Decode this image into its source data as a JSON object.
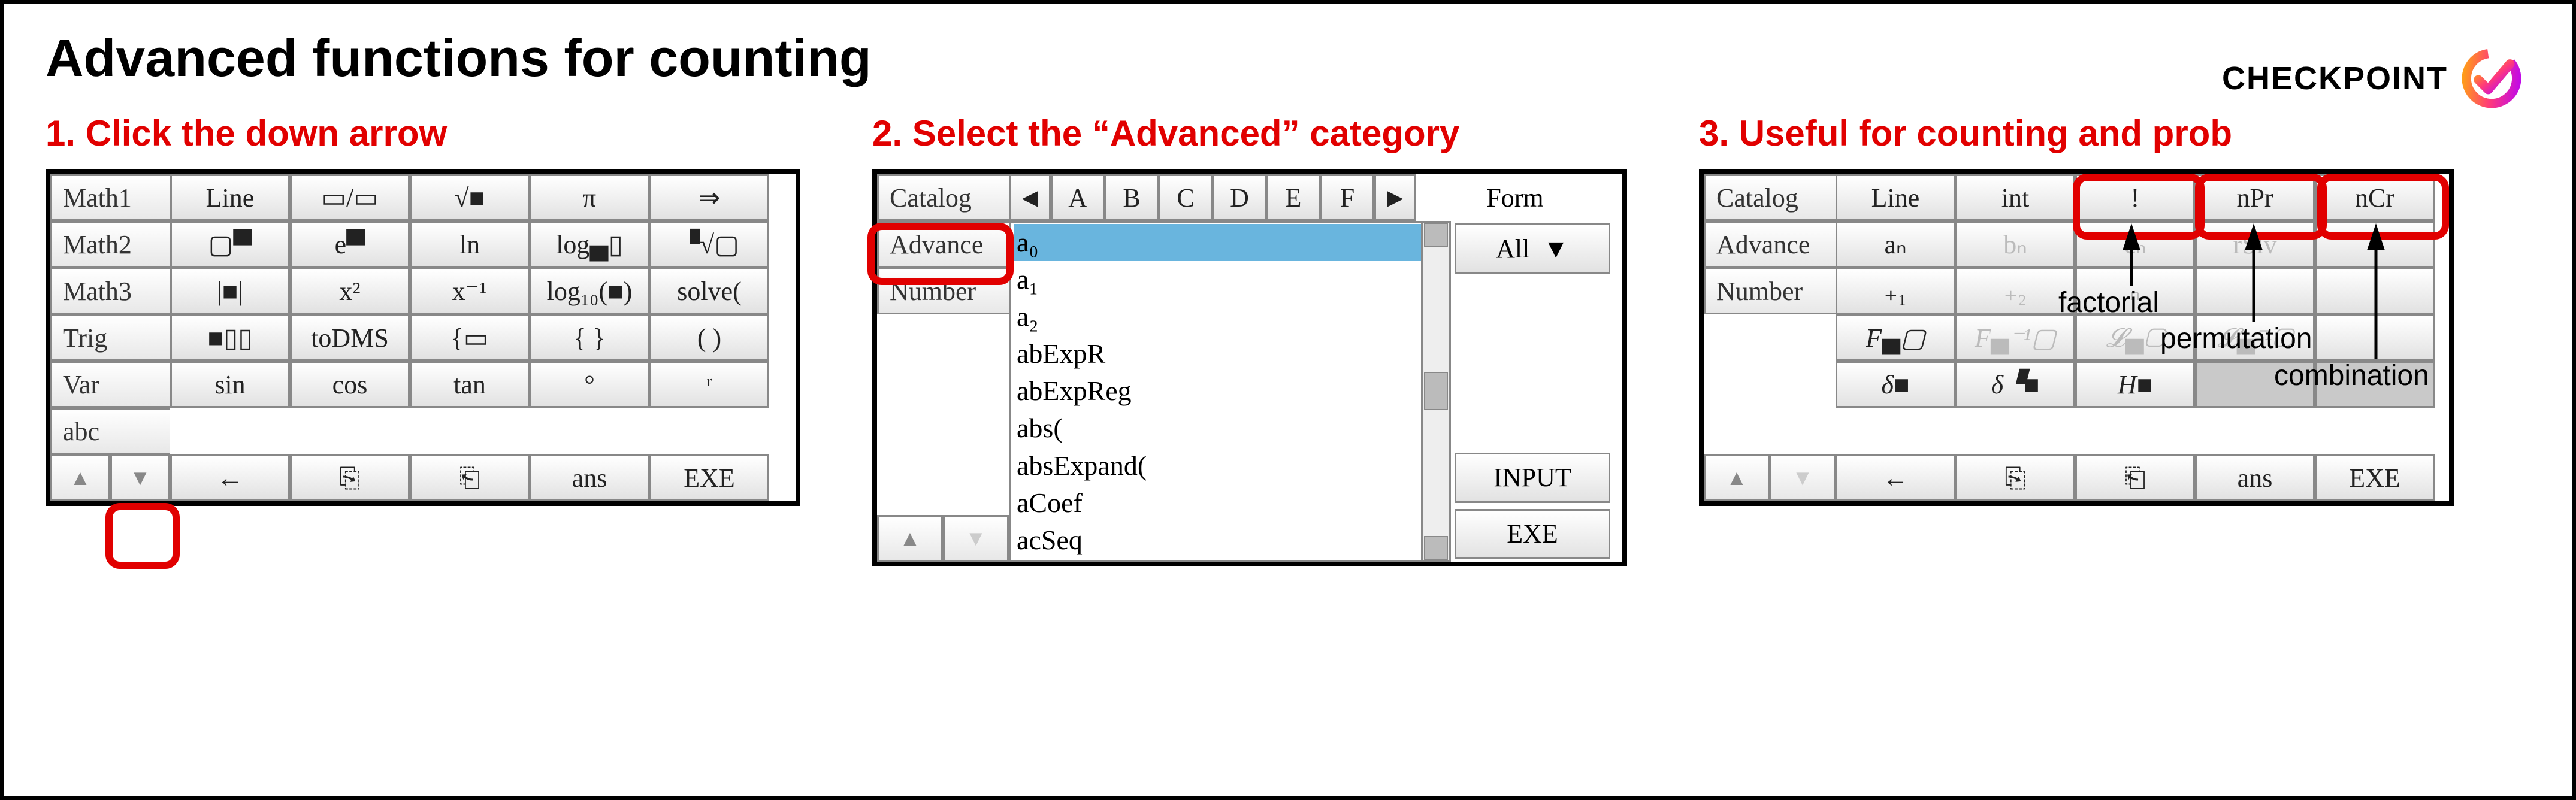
{
  "title": "Advanced functions for counting",
  "logo_text": "CHECKPOINT",
  "step1": {
    "heading": "1. Click the down arrow",
    "tabs": [
      "Math1",
      "Math2",
      "Math3",
      "Trig",
      "Var",
      "abc"
    ],
    "row0": [
      "Line",
      "▭/▭",
      "√■",
      "π",
      "⇒"
    ],
    "row1": [
      "▢▀",
      "e▀",
      "ln",
      "log▄▯",
      "▝√▢"
    ],
    "row2": [
      "|■|",
      "x²",
      "x⁻¹",
      "log₁₀(■)",
      "solve("
    ],
    "row3": [
      "■▯▯",
      "toDMS",
      "{▭",
      "{ }",
      "( )"
    ],
    "row4": [
      "sin",
      "cos",
      "tan",
      "°",
      "ʳ"
    ],
    "row5": [
      "←",
      "⎘",
      "⎗",
      "ans",
      "EXE"
    ]
  },
  "step2": {
    "heading": "2. Select the “Advanced” category",
    "tabs": [
      "Catalog",
      "Advance",
      "Number"
    ],
    "letters_left": "◄",
    "letters": [
      "A",
      "B",
      "C",
      "D",
      "E",
      "F"
    ],
    "letters_right": "►",
    "form_label": "Form",
    "form_value": "All",
    "list": [
      "a₀",
      "a₁",
      "a₂",
      "abExpR",
      "abExpReg",
      "abs(",
      "absExpand(",
      "aCoef",
      "acSeq"
    ],
    "input_btn": "INPUT",
    "exe_btn": "EXE"
  },
  "step3": {
    "heading": "3. Useful for counting and prob",
    "tabs": [
      "Catalog",
      "Advance",
      "Number"
    ],
    "row0": [
      "Line",
      "int",
      "!",
      "nPr",
      "nCr"
    ],
    "row1": [
      "aₙ",
      "bₙ",
      "cₙ",
      "rSlv",
      ""
    ],
    "row2": [
      "₊₁",
      "₊₂",
      "ₙ",
      "",
      ""
    ],
    "row3": [
      "F▄▢",
      "F▄⁻¹▢",
      "𝓛▄▢",
      "𝓛▄⁻¹▢",
      ""
    ],
    "row4": [
      "δ■",
      "δ▝■",
      "H■",
      "",
      ""
    ],
    "row5": [
      "←",
      "⎘",
      "⎗",
      "ans",
      "EXE"
    ],
    "ann_factorial": "factorial",
    "ann_permutation": "permutation",
    "ann_combination": "combination"
  }
}
